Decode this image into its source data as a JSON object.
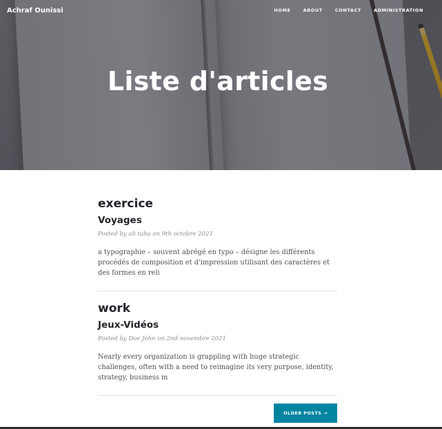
{
  "nav": {
    "brand": "Achraf Ounissi",
    "links": [
      "HOME",
      "ABOUT",
      "CONTACT",
      "ADMINISTRATION"
    ]
  },
  "hero": {
    "title": "Liste d'articles"
  },
  "posts": [
    {
      "title": "exercice",
      "subtitle": "Voyages",
      "meta": "Posted by ali taha on 9th octobre 2021",
      "excerpt": "a typographie – souvent abrégé en typo – désigne les différents procédés de composition et d'impression utilisant des caractères et des formes en reli"
    },
    {
      "title": "work",
      "subtitle": "Jeux-Vidéos",
      "meta": "Posted by Doe John on 2nd novembre 2021",
      "excerpt": "Nearly every organization is grappling with huge strategic challenges, often with a need to reimagine its very purpose, identity, strategy, business m"
    }
  ],
  "pager": {
    "older_label": "OLDER POSTS →"
  },
  "colors": {
    "accent": "#0085a1",
    "text": "#212529",
    "meta": "#868e96"
  }
}
